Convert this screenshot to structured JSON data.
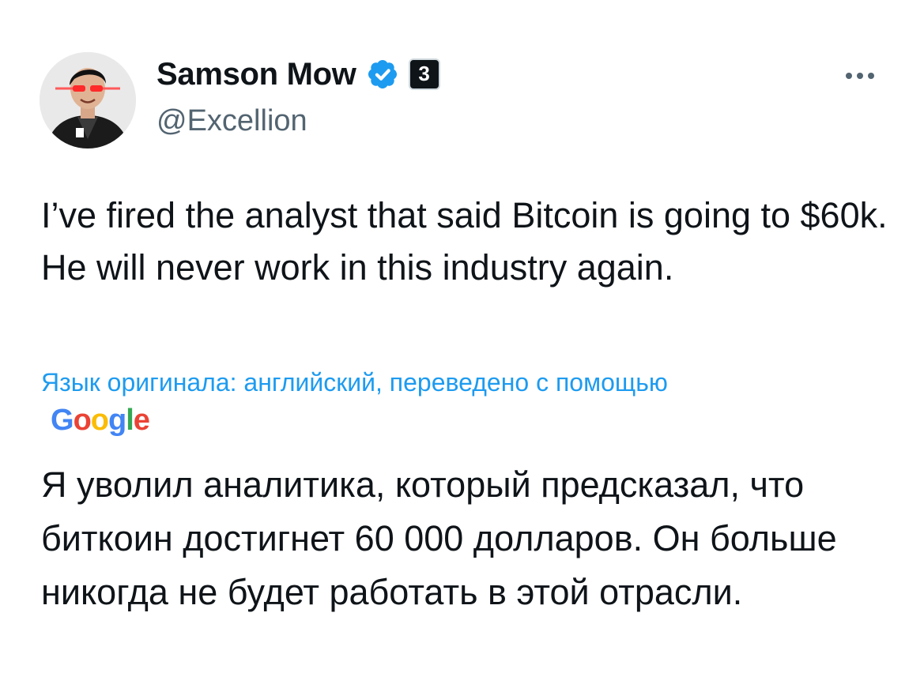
{
  "author": {
    "display_name": "Samson Mow",
    "handle": "@Excellion",
    "affiliate_badge_text": "3"
  },
  "icons": {
    "verified": "verified-badge-icon",
    "more": "more-options-icon",
    "avatar": "profile-avatar"
  },
  "colors": {
    "accent": "#1d9bf0",
    "secondary_text": "#536471",
    "primary_text": "#0f1419"
  },
  "tweet": {
    "text": "I’ve fired the analyst that said Bitcoin is going to $60k. He will never work in this industry again.",
    "translation_note": "Язык оригинала: английский, переведено с помощью",
    "translation_provider": "Google",
    "translated_text": "Я уволил аналитика, который предсказал, что биткоин достигнет 60 000 долларов. Он больше никогда не будет работать в этой отрасли."
  }
}
